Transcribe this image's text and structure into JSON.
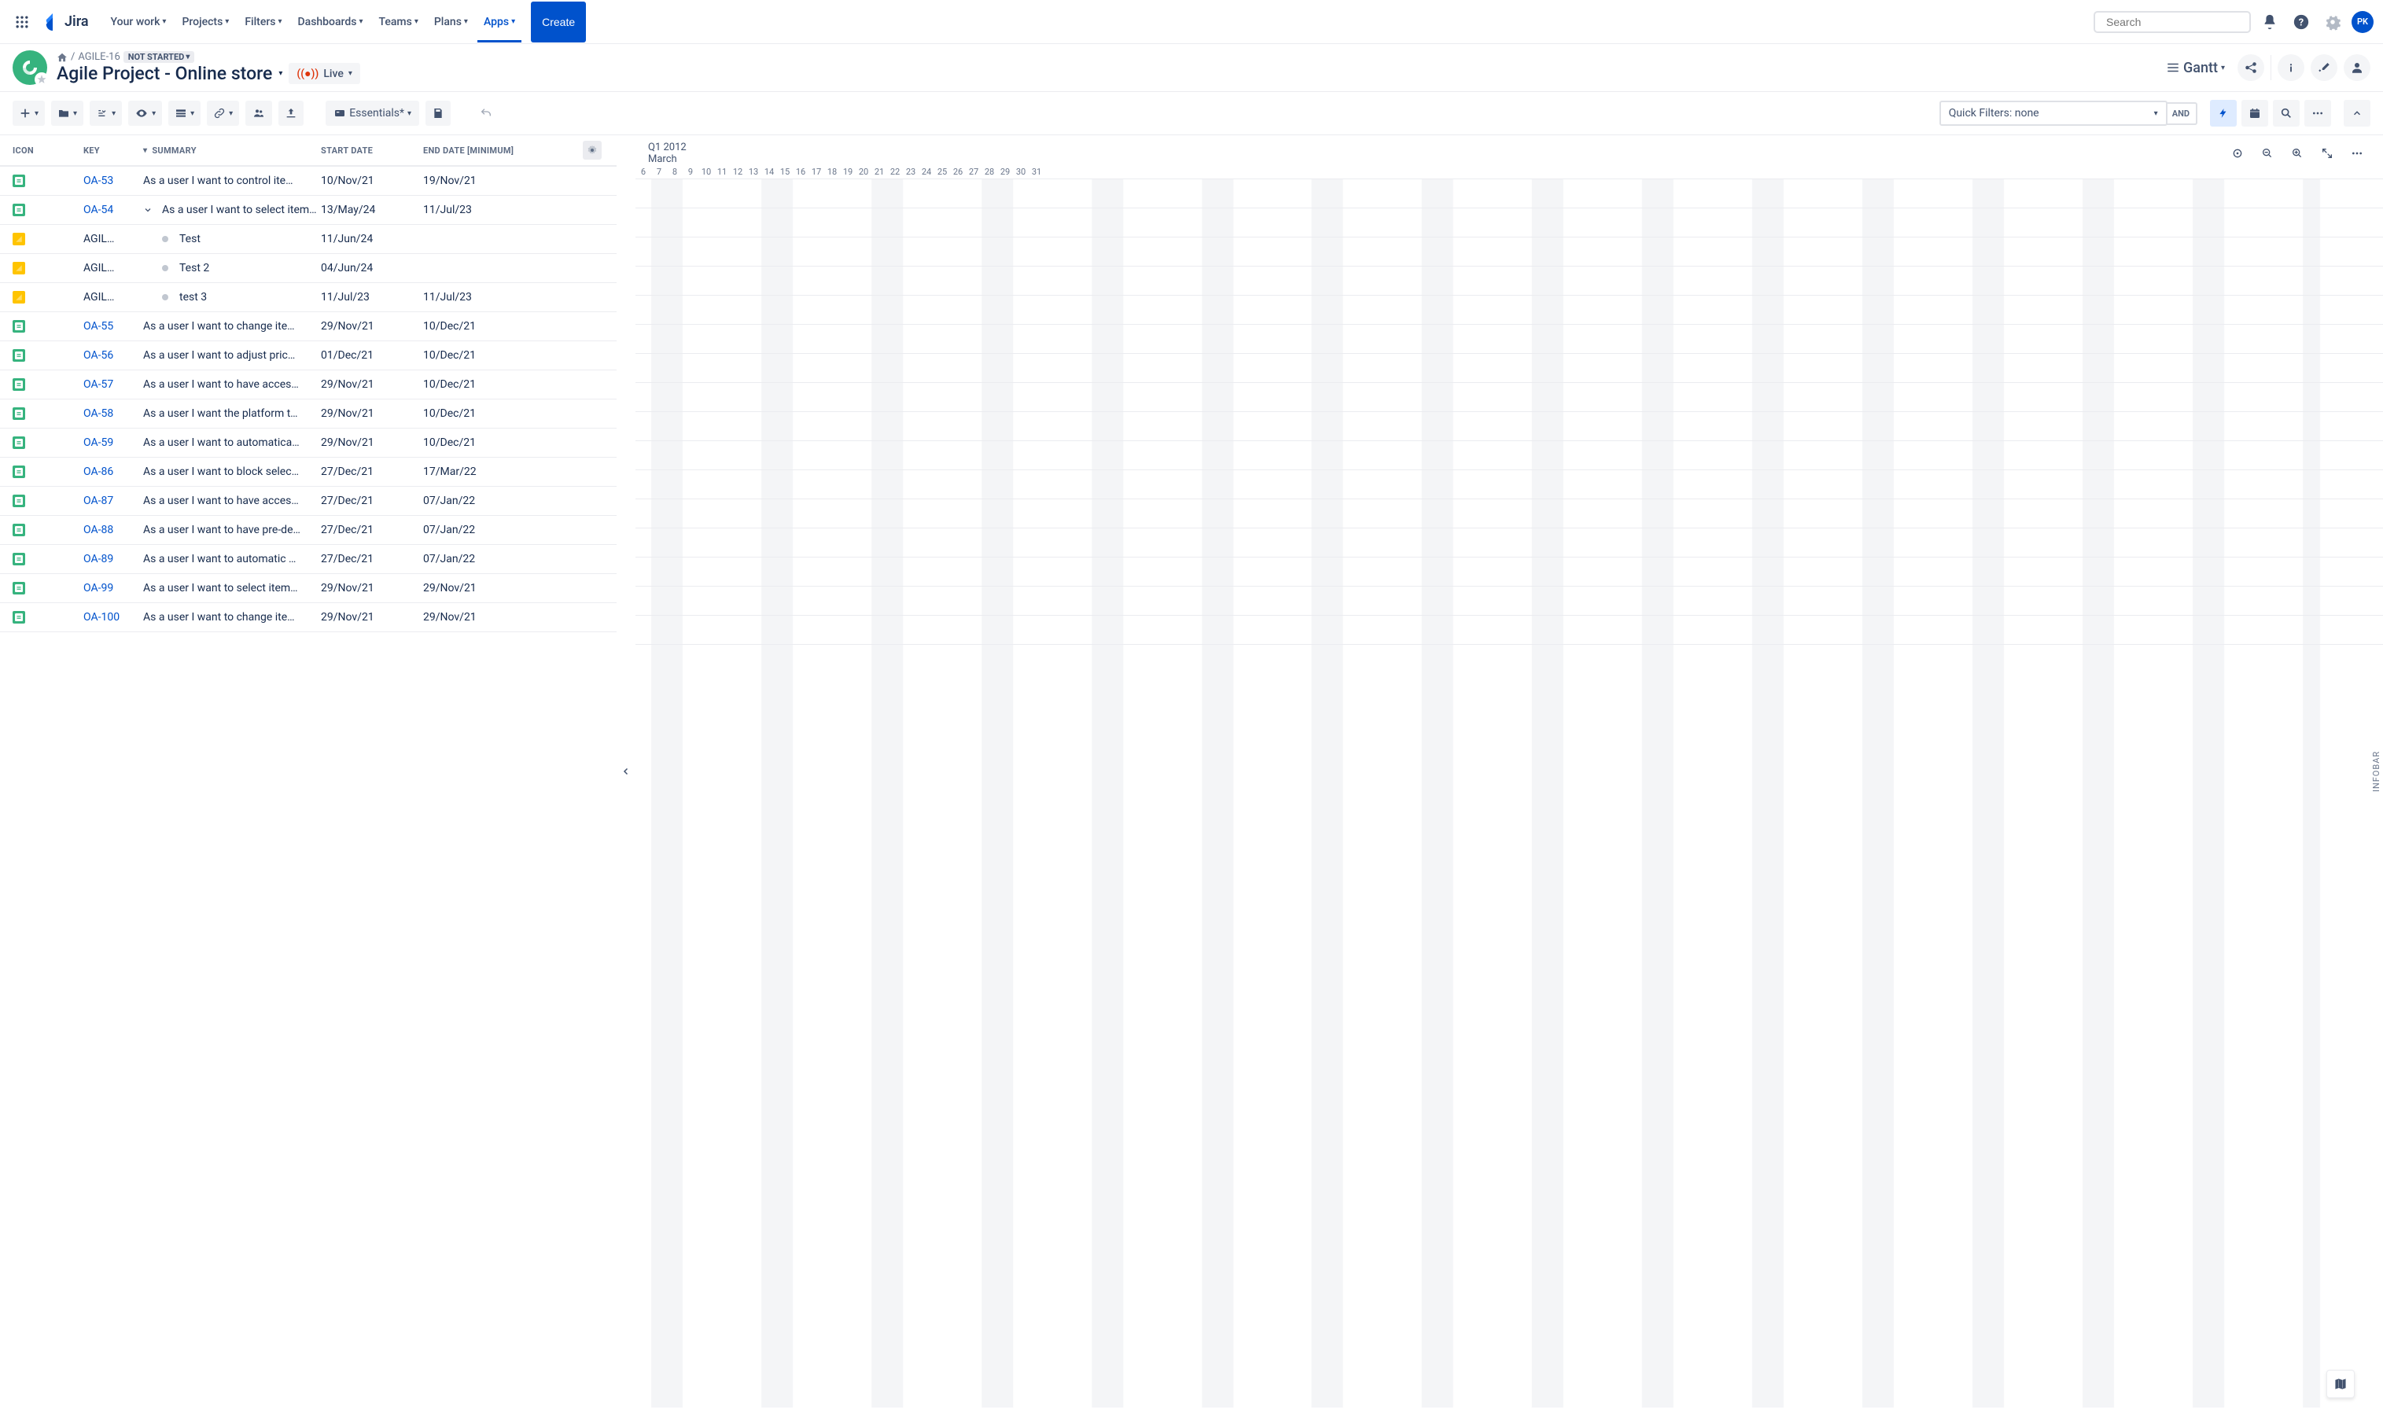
{
  "header": {
    "logo": "Jira",
    "nav": [
      "Your work",
      "Projects",
      "Filters",
      "Dashboards",
      "Teams",
      "Plans",
      "Apps"
    ],
    "create": "Create",
    "search_placeholder": "Search",
    "avatar": "PK"
  },
  "breadcrumb": {
    "project": "AGILE-16",
    "status": "NOT STARTED"
  },
  "project": {
    "title": "Agile Project - Online store",
    "live": "Live",
    "view": "Gantt"
  },
  "toolbar": {
    "essentials": "Essentials*",
    "filters_label": "Quick Filters: none",
    "and": "AND"
  },
  "columns": {
    "icon": "ICON",
    "key": "KEY",
    "summary": "SUMMARY",
    "start": "START DATE",
    "end": "END DATE [MINIMUM]"
  },
  "rows": [
    {
      "type": "green",
      "key": "OA-53",
      "link": true,
      "summary": "As a user I want to control item …",
      "start": "10/Nov/21",
      "end": "19/Nov/21"
    },
    {
      "type": "green",
      "key": "OA-54",
      "link": true,
      "expand": true,
      "summary": "As a user I want to select items f…",
      "start": "13/May/24",
      "end": "11/Jul/23"
    },
    {
      "type": "yellow",
      "key": "AGIL…",
      "link": false,
      "child": true,
      "summary": "Test",
      "start": "11/Jun/24",
      "end": ""
    },
    {
      "type": "yellow",
      "key": "AGIL…",
      "link": false,
      "child": true,
      "summary": "Test 2",
      "start": "04/Jun/24",
      "end": ""
    },
    {
      "type": "yellow",
      "key": "AGIL…",
      "link": false,
      "child": true,
      "last": true,
      "summary": "test 3",
      "start": "11/Jul/23",
      "end": "11/Jul/23"
    },
    {
      "type": "green",
      "key": "OA-55",
      "link": true,
      "summary": "As a user I want to change item …",
      "start": "29/Nov/21",
      "end": "10/Dec/21"
    },
    {
      "type": "green",
      "key": "OA-56",
      "link": true,
      "summary": "As a user I want to adjust prices…",
      "start": "01/Dec/21",
      "end": "10/Dec/21"
    },
    {
      "type": "green",
      "key": "OA-57",
      "link": true,
      "summary": "As a user I want to have access …",
      "start": "29/Nov/21",
      "end": "10/Dec/21"
    },
    {
      "type": "green",
      "key": "OA-58",
      "link": true,
      "summary": "As a user I want the platform to …",
      "start": "29/Nov/21",
      "end": "10/Dec/21"
    },
    {
      "type": "green",
      "key": "OA-59",
      "link": true,
      "summary": "As a user I want to automatically…",
      "start": "29/Nov/21",
      "end": "10/Dec/21"
    },
    {
      "type": "green",
      "key": "OA-86",
      "link": true,
      "summary": "As a user I want to block selecte…",
      "start": "27/Dec/21",
      "end": "17/Mar/22"
    },
    {
      "type": "green",
      "key": "OA-87",
      "link": true,
      "summary": "As a user I want to have access …",
      "start": "27/Dec/21",
      "end": "07/Jan/22"
    },
    {
      "type": "green",
      "key": "OA-88",
      "link": true,
      "summary": "As a user I want to have pre-defi…",
      "start": "27/Dec/21",
      "end": "07/Jan/22"
    },
    {
      "type": "green",
      "key": "OA-89",
      "link": true,
      "summary": "As a user I want to automatic m…",
      "start": "27/Dec/21",
      "end": "07/Jan/22"
    },
    {
      "type": "green",
      "key": "OA-99",
      "link": true,
      "summary": "As a user I want to select items f…",
      "start": "29/Nov/21",
      "end": "29/Nov/21"
    },
    {
      "type": "green",
      "key": "OA-100",
      "link": true,
      "summary": "As a user I want to change item …",
      "start": "29/Nov/21",
      "end": "29/Nov/21"
    }
  ],
  "timeline": {
    "quarter": "Q1 2012",
    "month": "March",
    "days": [
      "6",
      "7",
      "8",
      "9",
      "10",
      "11",
      "12",
      "13",
      "14",
      "15",
      "16",
      "17",
      "18",
      "19",
      "20",
      "21",
      "22",
      "23",
      "24",
      "25",
      "26",
      "27",
      "28",
      "29",
      "30",
      "31"
    ]
  },
  "infobar": "INFOBAR"
}
